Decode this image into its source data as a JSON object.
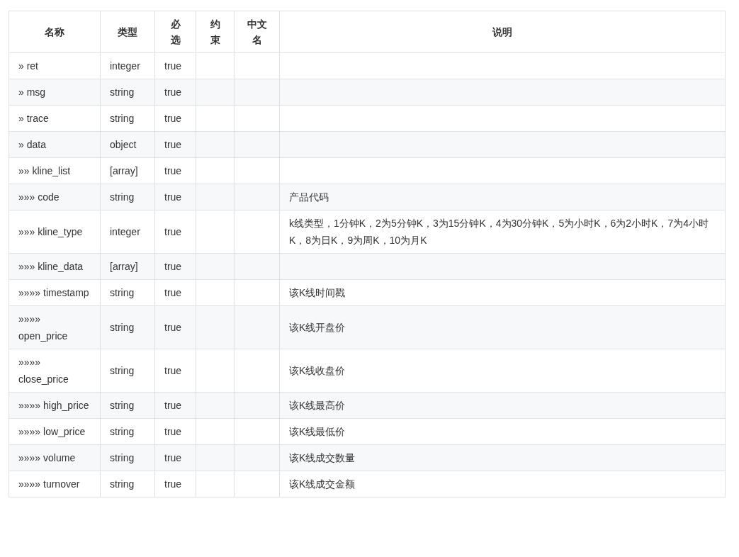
{
  "table": {
    "columns": [
      "名称",
      "类型",
      "必选",
      "约束",
      "中文名",
      "说明"
    ],
    "rows": [
      {
        "name": "» ret",
        "type": "integer",
        "required": "true",
        "description": ""
      },
      {
        "name": "» msg",
        "type": "string",
        "required": "true",
        "description": ""
      },
      {
        "name": "» trace",
        "type": "string",
        "required": "true",
        "description": ""
      },
      {
        "name": "» data",
        "type": "object",
        "required": "true",
        "description": ""
      },
      {
        "name": "»» kline_list",
        "type": "[array]",
        "required": "true",
        "description": ""
      },
      {
        "name": "»»» code",
        "type": "string",
        "required": "true",
        "description": "产品代码"
      },
      {
        "name": "»»» kline_type",
        "type": "integer",
        "required": "true",
        "description": "k线类型，1分钟K，2为5分钟K，3为15分钟K，4为30分钟K，5为小时K，6为2小时K，7为4小时K，8为日K，9为周K，10为月K"
      },
      {
        "name": "»»» kline_data",
        "type": "[array]",
        "required": "true",
        "description": ""
      },
      {
        "name": "»»»» timestamp",
        "type": "string",
        "required": "true",
        "description": "该K线时间戳"
      },
      {
        "name": "»»»» open_price",
        "type": "string",
        "required": "true",
        "description": "该K线开盘价"
      },
      {
        "name": "»»»» close_price",
        "type": "string",
        "required": "true",
        "description": "该K线收盘价"
      },
      {
        "name": "»»»» high_price",
        "type": "string",
        "required": "true",
        "description": "该K线最高价"
      },
      {
        "name": "»»»» low_price",
        "type": "string",
        "required": "true",
        "description": "该K线最低价"
      },
      {
        "name": "»»»» volume",
        "type": "string",
        "required": "true",
        "description": "该K线成交数量"
      },
      {
        "name": "»»»» turnover",
        "type": "string",
        "required": "true",
        "description": "该K线成交金额"
      }
    ]
  }
}
